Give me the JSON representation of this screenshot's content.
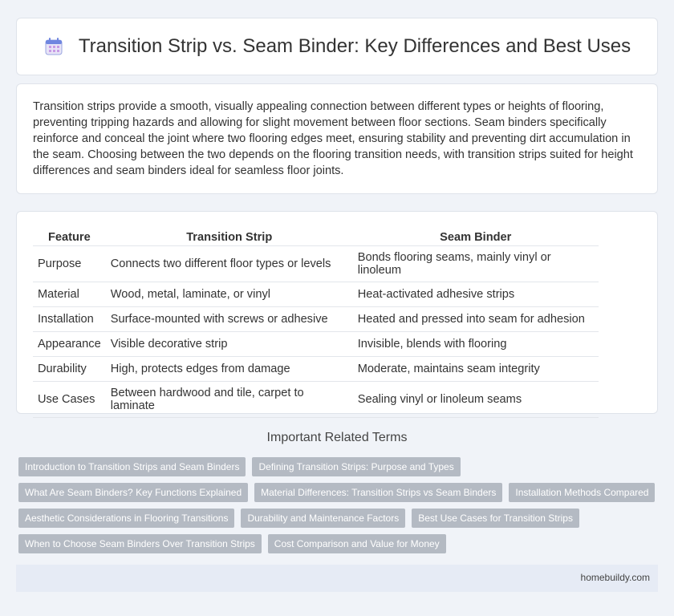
{
  "header": {
    "title": "Transition Strip vs. Seam Binder: Key Differences and Best Uses",
    "icon": "calendar-icon"
  },
  "intro": {
    "text": "Transition strips provide a smooth, visually appealing connection between different types or heights of flooring, preventing tripping hazards and allowing for slight movement between floor sections. Seam binders specifically reinforce and conceal the joint where two flooring edges meet, ensuring stability and preventing dirt accumulation in the seam. Choosing between the two depends on the flooring transition needs, with transition strips suited for height differences and seam binders ideal for seamless floor joints."
  },
  "table": {
    "headers": [
      "Feature",
      "Transition Strip",
      "Seam Binder"
    ],
    "rows": [
      [
        "Purpose",
        "Connects two different floor types or levels",
        "Bonds flooring seams, mainly vinyl or linoleum"
      ],
      [
        "Material",
        "Wood, metal, laminate, or vinyl",
        "Heat-activated adhesive strips"
      ],
      [
        "Installation",
        "Surface-mounted with screws or adhesive",
        "Heated and pressed into seam for adhesion"
      ],
      [
        "Appearance",
        "Visible decorative strip",
        "Invisible, blends with flooring"
      ],
      [
        "Durability",
        "High, protects edges from damage",
        "Moderate, maintains seam integrity"
      ],
      [
        "Use Cases",
        "Between hardwood and tile, carpet to laminate",
        "Sealing vinyl or linoleum seams"
      ]
    ]
  },
  "related": {
    "title": "Important Related Terms",
    "rows": [
      [
        "Introduction to Transition Strips and Seam Binders",
        "Defining Transition Strips: Purpose and Types"
      ],
      [
        "What Are Seam Binders? Key Functions Explained",
        "Material Differences: Transition Strips vs Seam Binders",
        "Installation Methods Compared"
      ],
      [
        "Aesthetic Considerations in Flooring Transitions",
        "Durability and Maintenance Factors",
        "Best Use Cases for Transition Strips"
      ],
      [
        "When to Choose Seam Binders Over Transition Strips",
        "Cost Comparison and Value for Money"
      ]
    ]
  },
  "footer": {
    "site": "homebuildy.com"
  },
  "colors": {
    "background": "#f0f3f8",
    "tag": "#b4bac3",
    "footer": "#e6ebf5"
  }
}
